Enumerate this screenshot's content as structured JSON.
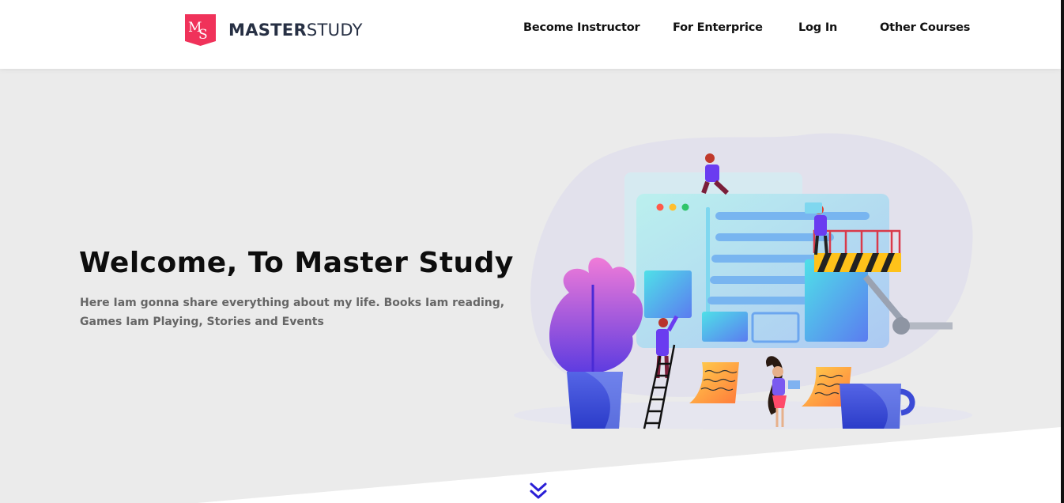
{
  "brand": {
    "monogram": "MS",
    "name_bold": "MASTER",
    "name_light": "STUDY",
    "color": "#f0325a"
  },
  "nav": {
    "items": [
      {
        "label": "Become Instructor"
      },
      {
        "label": "For Enterprice"
      },
      {
        "label": "Log In"
      },
      {
        "label": "Other Courses"
      }
    ]
  },
  "hero": {
    "title": "Welcome, To Master Study",
    "subtitle": "Here Iam gonna share everything about my life. Books Iam reading, Games Iam Playing, Stories and Events"
  },
  "scroll_indicator": {
    "icon": "double-chevron-down-icon",
    "color": "#2a1fd6"
  },
  "colors": {
    "hero_background": "#ebebeb",
    "header_background": "#ffffff",
    "text_dark": "#0d0d0d",
    "text_muted": "#666666"
  }
}
